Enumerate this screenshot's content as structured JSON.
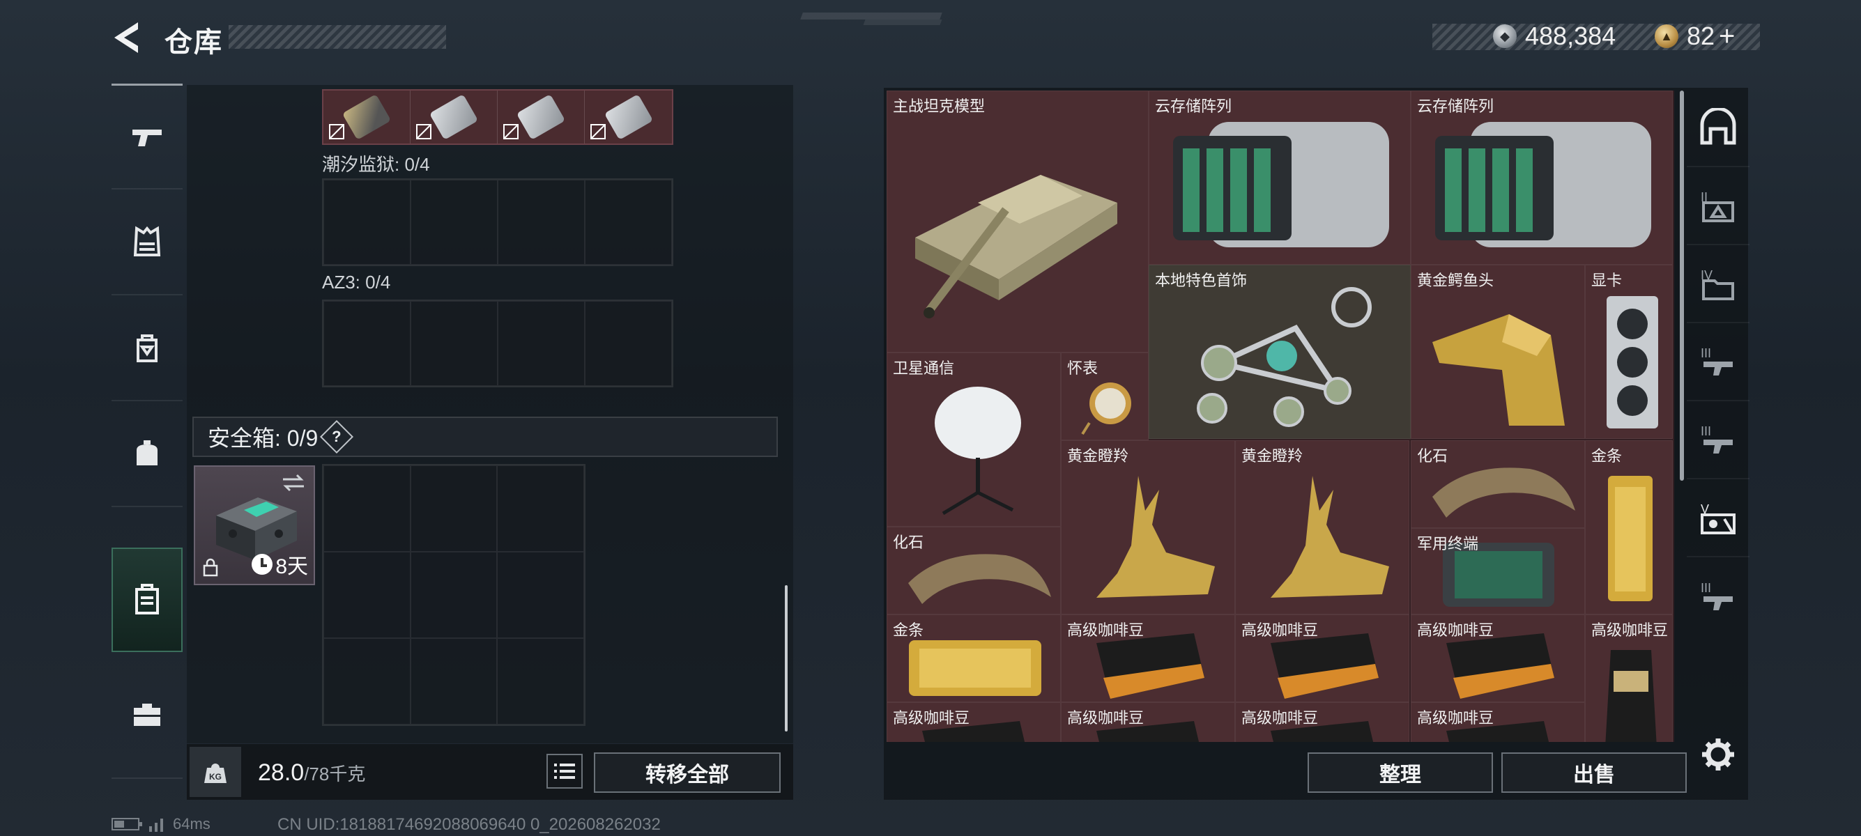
{
  "header": {
    "title": "仓库",
    "currencies": [
      {
        "icon": "silver-coin-icon",
        "value": "488,384"
      },
      {
        "icon": "gold-coin-icon",
        "value": "82",
        "add_label": "+"
      }
    ]
  },
  "left_nav": {
    "items": [
      {
        "icon": "gun-icon"
      },
      {
        "icon": "vest-icon"
      },
      {
        "icon": "backpack-icon"
      },
      {
        "icon": "pouch-icon"
      },
      {
        "icon": "safebox-icon",
        "active": true
      },
      {
        "icon": "briefcase-icon"
      }
    ]
  },
  "storage": {
    "containers": [
      {
        "label": "潮汐监狱: 0/4"
      },
      {
        "label": "AZ3: 0/4"
      }
    ],
    "safe_box": {
      "label": "安全箱: 0/9",
      "help": "?",
      "timer": "8天"
    },
    "weight": {
      "current": "28.0",
      "max": "/78千克"
    },
    "transfer_all_label": "转移全部"
  },
  "inventory": {
    "accent_bg": "#4b2d31",
    "items": [
      {
        "name": "主战坦克模型",
        "icon": "tank-icon"
      },
      {
        "name": "云存储阵列",
        "icon": "server-icon"
      },
      {
        "name": "云存储阵列",
        "icon": "server-icon"
      },
      {
        "name": "本地特色首饰",
        "icon": "jewelry-icon"
      },
      {
        "name": "黄金鳄鱼头",
        "icon": "gold-croc-icon"
      },
      {
        "name": "显卡",
        "icon": "gpu-icon"
      },
      {
        "name": "卫星通信",
        "icon": "satellite-icon"
      },
      {
        "name": "怀表",
        "icon": "pocket-watch-icon"
      },
      {
        "name": "黄金瞪羚",
        "icon": "gold-gazelle-icon"
      },
      {
        "name": "黄金瞪羚",
        "icon": "gold-gazelle-icon"
      },
      {
        "name": "化石",
        "icon": "fossil-icon"
      },
      {
        "name": "金条",
        "icon": "gold-bar-icon"
      },
      {
        "name": "化石",
        "icon": "fossil-icon"
      },
      {
        "name": "军用终端",
        "icon": "terminal-icon"
      },
      {
        "name": "金条",
        "icon": "gold-bar-icon"
      },
      {
        "name": "高级咖啡豆",
        "icon": "coffee-icon"
      },
      {
        "name": "高级咖啡豆",
        "icon": "coffee-icon"
      },
      {
        "name": "高级咖啡豆",
        "icon": "coffee-icon"
      },
      {
        "name": "高级咖啡豆",
        "icon": "coffee-icon"
      },
      {
        "name": "高级咖啡豆",
        "icon": "coffee-icon"
      },
      {
        "name": "高级咖啡豆",
        "icon": "coffee-icon"
      },
      {
        "name": "高级咖啡豆",
        "icon": "coffee-icon"
      },
      {
        "name": "高级咖啡豆",
        "icon": "coffee-icon"
      }
    ],
    "organize_label": "整理",
    "sell_label": "出售"
  },
  "status_bar": {
    "ping": "64ms",
    "uid": "CN UID:18188174692088069640 0_202608262032"
  }
}
